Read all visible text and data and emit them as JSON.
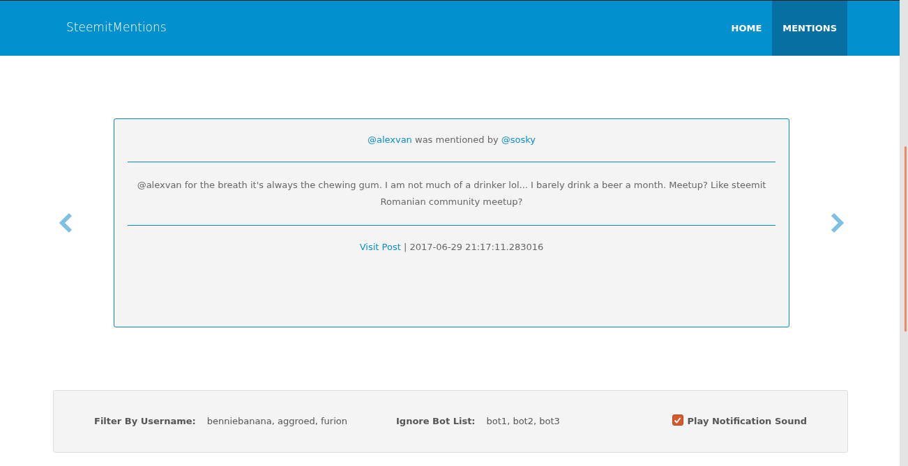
{
  "navbar": {
    "brand": "SteemitMentions",
    "items": [
      {
        "label": "HOME",
        "selected": false
      },
      {
        "label": "MENTIONS",
        "selected": true
      }
    ]
  },
  "mention": {
    "mentioned": "@alexvan",
    "connector": "was mentioned by",
    "author": "@sosky",
    "body": "@alexvan for the breath it's always the chewing gum. I am not much of a drinker lol... I barely drink a beer a month. Meetup? Like steemit Romanian community meetup?",
    "link": "Visit Post",
    "separator": "|",
    "timestamp": "2017-06-29 21:17:11.283016"
  },
  "filters": [
    {
      "kind": "text",
      "label": "Filter By Username:",
      "value": "benniebanana, aggroed, furion"
    },
    {
      "kind": "text",
      "label": "Ignore Bot List:",
      "value": "bot1, bot2, bot3"
    },
    {
      "kind": "checkbox",
      "label": "Play Notification Sound",
      "checked": true
    }
  ]
}
